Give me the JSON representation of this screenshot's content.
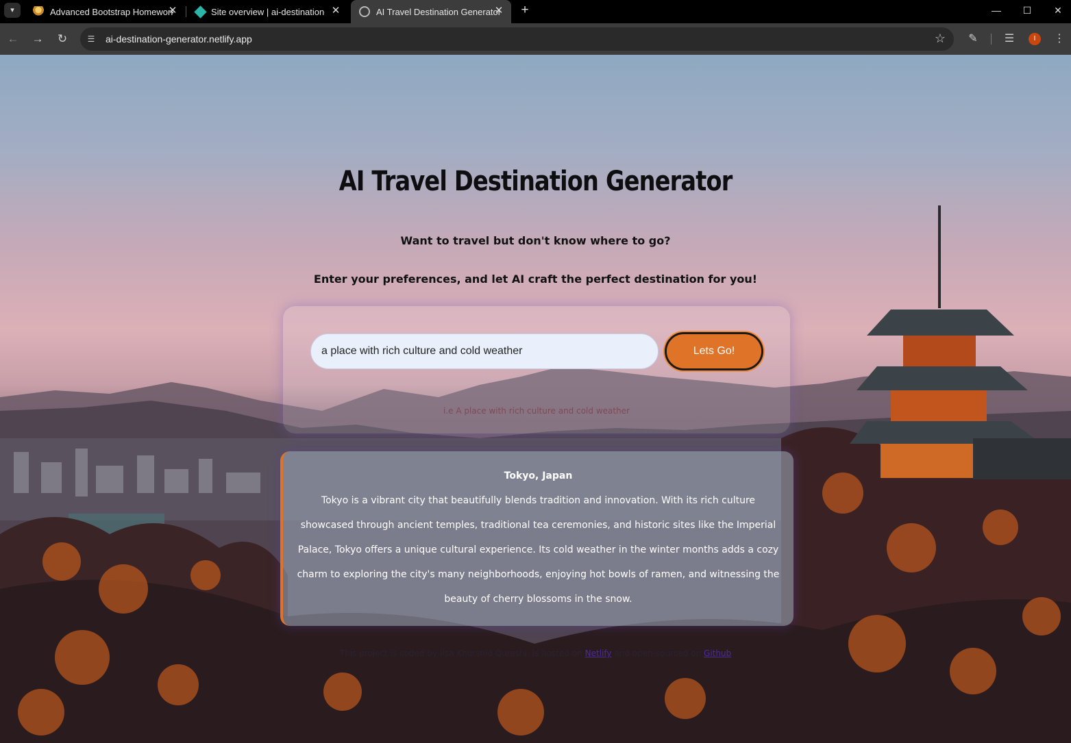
{
  "browser": {
    "tabs": [
      {
        "label": "Advanced Bootstrap Homework",
        "icon": "homework-favicon-icon",
        "active": false
      },
      {
        "label": "Site overview | ai-destination-g",
        "icon": "netlify-favicon-icon",
        "active": false
      },
      {
        "label": "AI Travel Destination Generator",
        "icon": "globe-favicon-icon",
        "active": true
      }
    ],
    "url": "ai-destination-generator.netlify.app",
    "profile_initial": "I"
  },
  "page": {
    "title": "AI Travel Destination Generator",
    "subtitle_1": "Want to travel but don't know where to go?",
    "subtitle_2": "Enter your preferences, and let AI craft the perfect destination for you!",
    "form": {
      "input_value": "a place with rich culture and cold weather",
      "button_label": "Lets Go!",
      "hint": "i.e A place with rich culture and cold weather"
    },
    "result": {
      "title": "Tokyo, Japan",
      "text": "Tokyo is a vibrant city that beautifully blends tradition and innovation. With its rich culture showcased through ancient temples, traditional tea ceremonies, and historic sites like the Imperial Palace, Tokyo offers a unique cultural experience. Its cold weather in the winter months adds a cozy charm to exploring the city's many neighborhoods, enjoying hot bowls of ramen, and witnessing the beauty of cherry blossoms in the snow."
    },
    "footer": {
      "prefix": "This project is coded by Ilsa Khurshid Qureshi, is hosted on ",
      "netlify_link": "Netlify",
      "middle": " and open-sourced on ",
      "github_link": "Github"
    }
  },
  "colors": {
    "accent": "#df7429",
    "glow": "#7a5ac0"
  }
}
